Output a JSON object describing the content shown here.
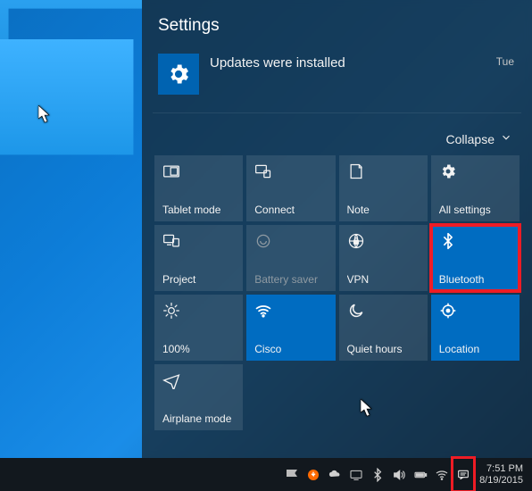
{
  "panel": {
    "title": "Settings",
    "notification": {
      "text": "Updates were installed",
      "timestamp": "Tue",
      "icon": "gear-icon"
    },
    "collapse_label": "Collapse"
  },
  "tiles": {
    "tablet_mode": {
      "label": "Tablet mode",
      "active": false,
      "highlight": false
    },
    "connect": {
      "label": "Connect",
      "active": false,
      "highlight": false
    },
    "note": {
      "label": "Note",
      "active": false,
      "highlight": false
    },
    "all_settings": {
      "label": "All settings",
      "active": false,
      "highlight": false
    },
    "project": {
      "label": "Project",
      "active": false,
      "highlight": false
    },
    "battery_saver": {
      "label": "Battery saver",
      "active": false,
      "highlight": false,
      "disabled": true
    },
    "vpn": {
      "label": "VPN",
      "active": false,
      "highlight": false
    },
    "bluetooth": {
      "label": "Bluetooth",
      "active": true,
      "highlight": true
    },
    "brightness": {
      "label": "100%",
      "active": false,
      "highlight": false
    },
    "wifi": {
      "label": "Cisco",
      "active": true,
      "highlight": false
    },
    "quiet_hours": {
      "label": "Quiet hours",
      "active": false,
      "highlight": false
    },
    "location": {
      "label": "Location",
      "active": true,
      "highlight": false
    },
    "airplane_mode": {
      "label": "Airplane mode",
      "active": false,
      "highlight": false
    }
  },
  "taskbar": {
    "clock": {
      "time": "7:51 PM",
      "date": "8/19/2015"
    },
    "action_center_highlight": true
  },
  "colors": {
    "accent": "#006cc1",
    "highlight": "#ee1c25"
  }
}
